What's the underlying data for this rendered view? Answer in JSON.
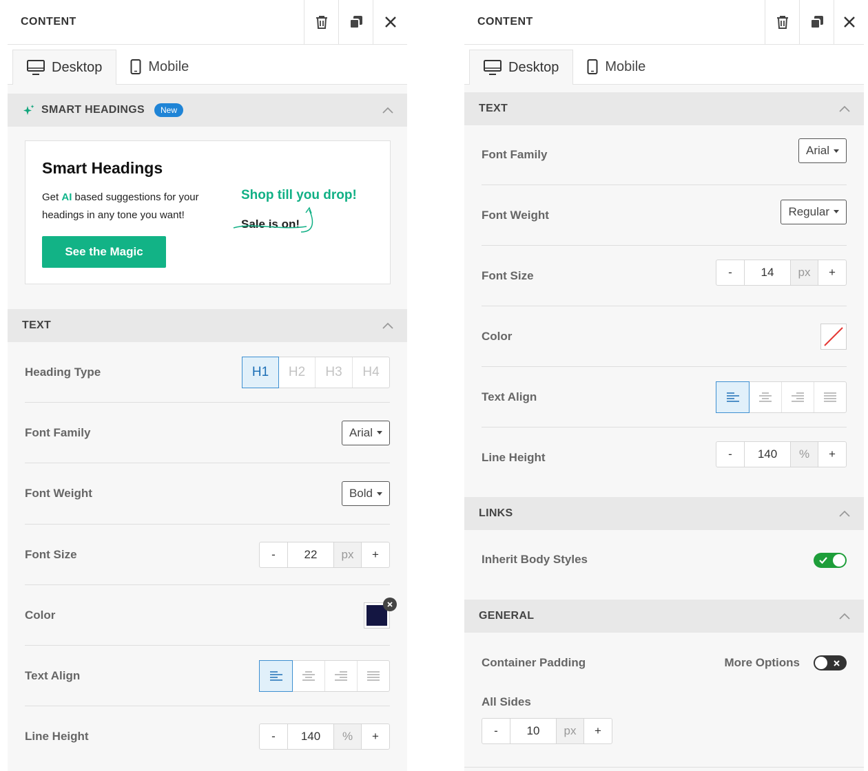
{
  "left": {
    "header": {
      "title": "CONTENT"
    },
    "tabs": {
      "desktop": "Desktop",
      "mobile": "Mobile"
    },
    "smart": {
      "section_title": "SMART HEADINGS",
      "badge": "New",
      "card_title": "Smart Headings",
      "desc_pre": "Get ",
      "desc_ai": "AI",
      "desc_post": " based suggestions for your headings in any tone you want!",
      "button": "See the Magic",
      "example_new": "Shop till you drop!",
      "example_old": "Sale is on!"
    },
    "text": {
      "section_title": "TEXT",
      "heading_type": {
        "label": "Heading Type",
        "options": [
          "H1",
          "H2",
          "H3",
          "H4"
        ],
        "selected": "H1"
      },
      "font_family": {
        "label": "Font Family",
        "value": "Arial"
      },
      "font_weight": {
        "label": "Font Weight",
        "value": "Bold"
      },
      "font_size": {
        "label": "Font Size",
        "minus": "-",
        "value": "22",
        "unit": "px",
        "plus": "+"
      },
      "color": {
        "label": "Color",
        "value": "#141642"
      },
      "text_align": {
        "label": "Text Align",
        "selected": "left"
      },
      "line_height": {
        "label": "Line Height",
        "minus": "-",
        "value": "140",
        "unit": "%",
        "plus": "+"
      }
    }
  },
  "right": {
    "header": {
      "title": "CONTENT"
    },
    "tabs": {
      "desktop": "Desktop",
      "mobile": "Mobile"
    },
    "text": {
      "section_title": "TEXT",
      "font_family": {
        "label": "Font Family",
        "value": "Arial"
      },
      "font_weight": {
        "label": "Font Weight",
        "value": "Regular"
      },
      "font_size": {
        "label": "Font Size",
        "minus": "-",
        "value": "14",
        "unit": "px",
        "plus": "+"
      },
      "color": {
        "label": "Color",
        "value": "none"
      },
      "text_align": {
        "label": "Text Align",
        "selected": "left"
      },
      "line_height": {
        "label": "Line Height",
        "minus": "-",
        "value": "140",
        "unit": "%",
        "plus": "+"
      }
    },
    "links": {
      "section_title": "LINKS",
      "inherit": {
        "label": "Inherit Body Styles",
        "on": true
      }
    },
    "general": {
      "section_title": "GENERAL",
      "container_padding": {
        "label": "Container Padding",
        "more_options": "More Options",
        "more_on": false
      },
      "all_sides": {
        "label": "All Sides",
        "minus": "-",
        "value": "10",
        "unit": "px",
        "plus": "+"
      }
    }
  },
  "colors": {
    "accent": "#12b386",
    "select_blue": "#3d8fd1",
    "toggle_on": "#1e9e3a",
    "toggle_off": "#333333"
  }
}
